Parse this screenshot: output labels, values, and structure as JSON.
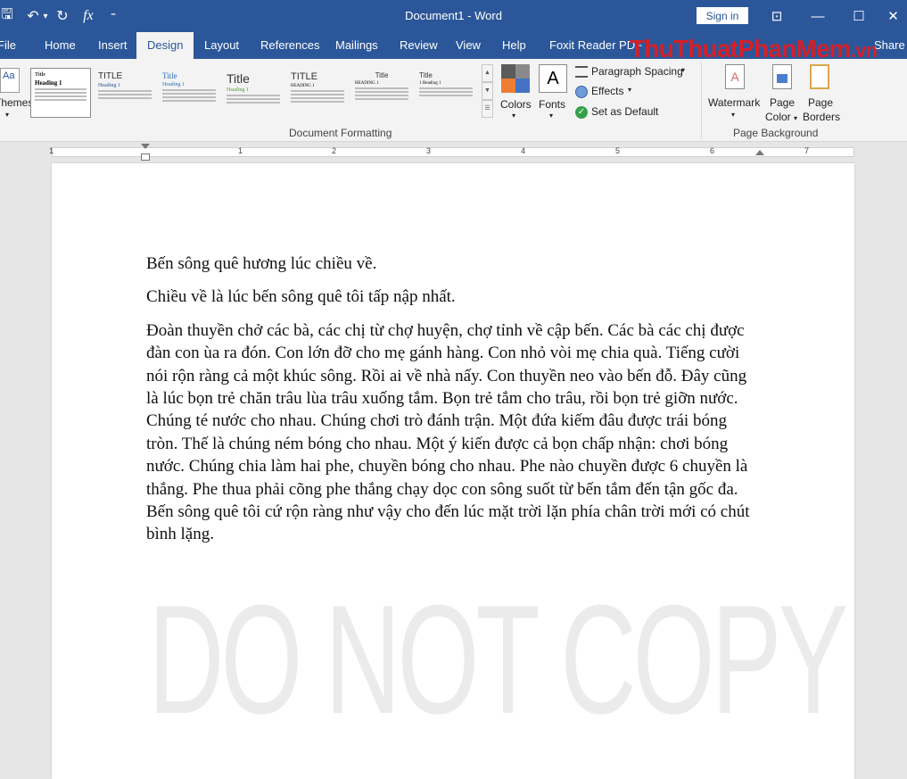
{
  "titlebar": {
    "title": "Document1 - Word",
    "signin": "Sign in",
    "fx": "fx",
    "save": "🖫",
    "undo": "↶",
    "undo_drop": "▾",
    "redo": "↻",
    "customize": "⁼"
  },
  "window": {
    "restore_ribbon": "⊡",
    "minimize": "—",
    "maximize": "☐",
    "close": "✕"
  },
  "tabs": [
    "File",
    "Home",
    "Insert",
    "Design",
    "Layout",
    "References",
    "Mailings",
    "Review",
    "View",
    "Help",
    "Foxit Reader PDF",
    "Share"
  ],
  "site_watermark": {
    "text": "ThuThuatPhanMem",
    "suffix": ".vn"
  },
  "ribbon": {
    "themes_label": "Themes",
    "style_thumbs": [
      {
        "title": "Title",
        "sub": "Heading 1"
      },
      {
        "title": "TITLE",
        "sub": "Heading 1"
      },
      {
        "title": "Title",
        "sub": "Heading 1"
      },
      {
        "title": "Title",
        "sub": "Heading 1"
      },
      {
        "title": "TITLE",
        "sub": "HEADING 1"
      },
      {
        "title": "Title",
        "sub": "HEADING 1"
      },
      {
        "title": "Title",
        "sub": "1 Heading 1"
      }
    ],
    "colors": "Colors",
    "fonts": "Fonts",
    "fonts_glyph": "A",
    "paragraph_spacing": "Paragraph Spacing",
    "effects": "Effects",
    "set_default": "Set as Default",
    "watermark": "Watermark",
    "page_color_1": "Page",
    "page_color_2": "Color",
    "page_borders_1": "Page",
    "page_borders_2": "Borders",
    "group_doc_formatting": "Document Formatting",
    "group_page_background": "Page Background"
  },
  "ruler": {
    "numbers": [
      "1",
      "1",
      "2",
      "3",
      "4",
      "5",
      "6",
      "7"
    ]
  },
  "document": {
    "paragraphs": [
      "Bến sông quê hương lúc chiều về.",
      "Chiều về là lúc bến sông quê tôi tấp nập nhất.",
      "Đoàn thuyền chở các bà, các chị từ chợ huyện, chợ tỉnh về cập bến. Các bà các chị được đàn con ùa ra đón. Con lớn đỡ cho mẹ gánh hàng. Con nhỏ vòi mẹ chia quà. Tiếng cười nói rộn ràng cả một khúc sông. Rồi ai về nhà nấy. Con thuyền neo vào bến đỗ. Đây cũng là lúc bọn trẻ chăn trâu lùa trâu xuống tắm. Bọn trẻ tắm cho trâu, rồi bọn trẻ giỡn nước. Chúng té nước cho nhau. Chúng chơi trò đánh trận. Một đứa kiếm đâu được trái bóng tròn. Thế là chúng ném bóng cho nhau. Một ý kiến được cả bọn chấp nhận: chơi bóng nước. Chúng chia làm hai phe, chuyền bóng cho nhau. Phe nào chuyền được 6 chuyền là thắng. Phe thua phải cõng phe thắng chạy dọc con sông suốt từ bến tắm đến tận gốc đa. Bến sông quê tôi cứ rộn ràng như vậy cho đến lúc mặt trời lặn phía chân trời mới có chút bình lặng."
    ],
    "watermark": "DO NOT COPY"
  }
}
